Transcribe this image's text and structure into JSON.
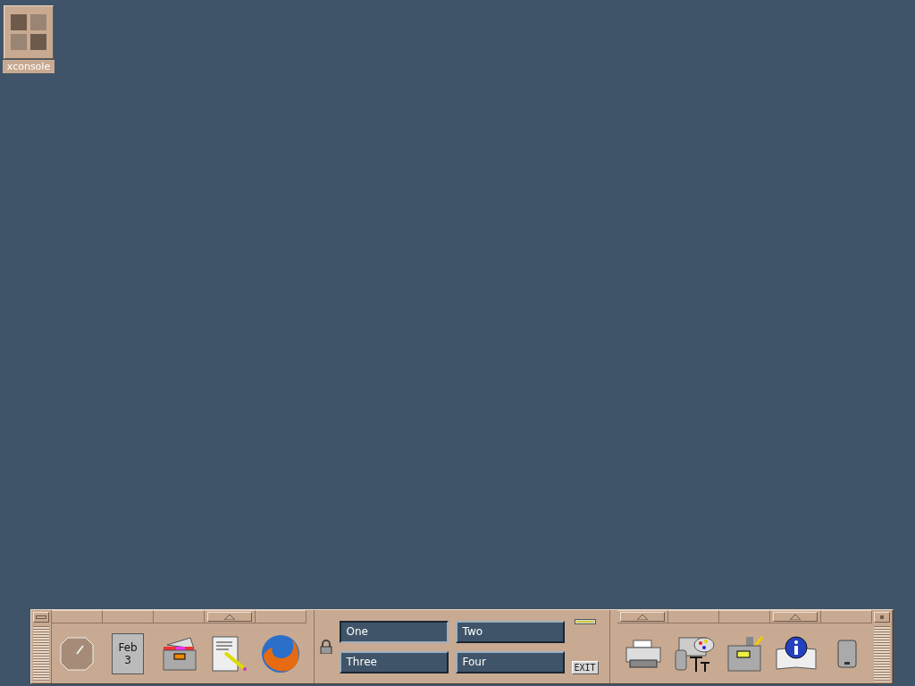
{
  "desktop_icons": [
    {
      "label": "xconsole"
    }
  ],
  "front_panel": {
    "left_slots": [
      {
        "kind": "clock",
        "subpanel": false
      },
      {
        "kind": "calendar",
        "subpanel": false,
        "month": "Feb",
        "day": "3"
      },
      {
        "kind": "files",
        "subpanel": false
      },
      {
        "kind": "editor",
        "subpanel": true
      },
      {
        "kind": "browser",
        "subpanel": false
      }
    ],
    "workspaces": [
      {
        "label": "One",
        "selected": true
      },
      {
        "label": "Two",
        "selected": false
      },
      {
        "label": "Three",
        "selected": false
      },
      {
        "label": "Four",
        "selected": false
      }
    ],
    "exit_label": "EXIT",
    "right_slots": [
      {
        "kind": "printer",
        "subpanel": true
      },
      {
        "kind": "style",
        "subpanel": false
      },
      {
        "kind": "apps",
        "subpanel": false
      },
      {
        "kind": "help",
        "subpanel": true
      },
      {
        "kind": "trash",
        "subpanel": false
      }
    ]
  }
}
